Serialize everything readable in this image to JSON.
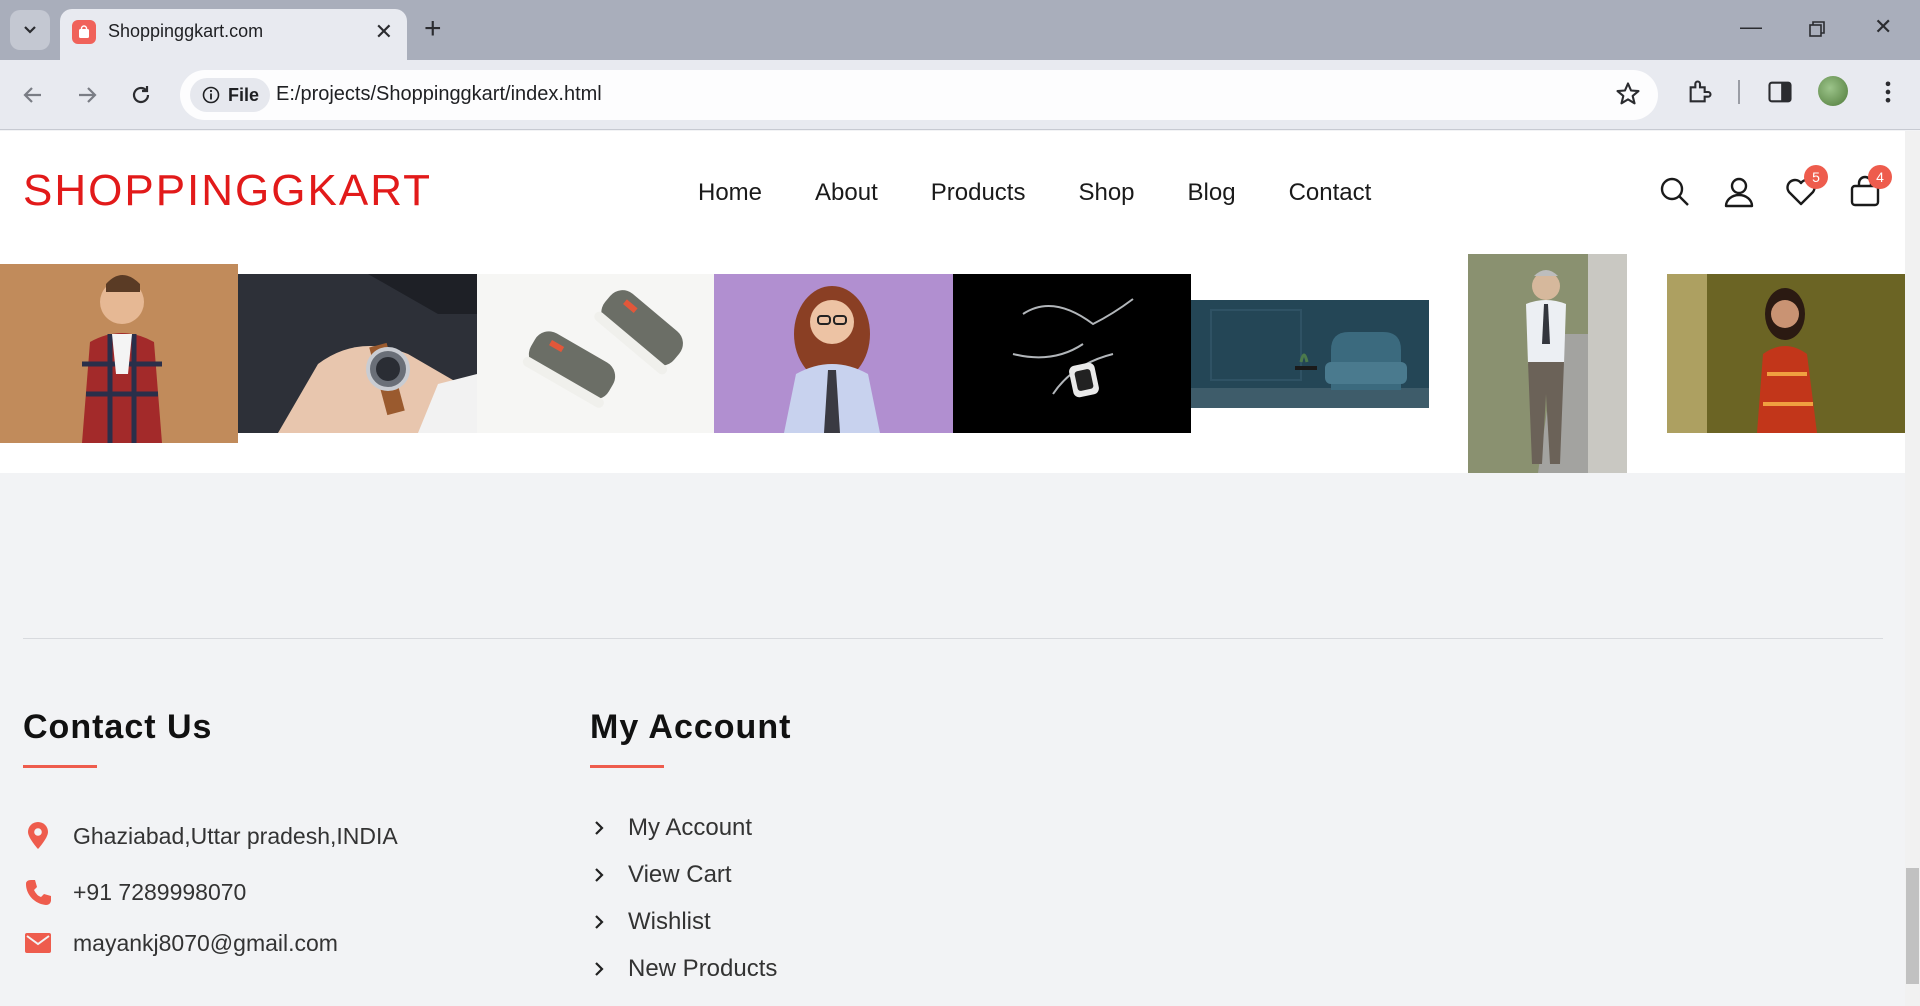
{
  "browser": {
    "tab_title": "Shoppinggkart.com",
    "url_chip": "File",
    "url": "E:/projects/Shoppinggkart/index.html",
    "colors": {
      "tabbar": "#a9aebb",
      "toolbar": "#e8eaf0",
      "favicon": "#f0625a"
    }
  },
  "header": {
    "logo": "SHOPPINGGKART",
    "nav": [
      "Home",
      "About",
      "Products",
      "Shop",
      "Blog",
      "Contact"
    ],
    "wishlist_count": "5",
    "cart_count": "4",
    "icons": [
      "search-icon",
      "user-icon",
      "heart-icon",
      "bag-icon"
    ]
  },
  "gallery": {
    "images": [
      "man-plaid-shirt",
      "wrist-watch",
      "sneakers",
      "woman-glasses",
      "smartwatch-splash",
      "blue-armchair",
      "man-walking",
      "woman-red-dress"
    ]
  },
  "footer": {
    "contact": {
      "title": "Contact Us",
      "address": "Ghaziabad,Uttar pradesh,INDIA",
      "phone": "+91 7289998070",
      "email": "mayankj8070@gmail.com"
    },
    "account": {
      "title": "My Account",
      "links": [
        "My Account",
        "View Cart",
        "Wishlist",
        "New Products"
      ]
    }
  },
  "colors": {
    "accent": "#ee5c4d",
    "logo": "#e21a1a",
    "page_bg": "#f2f3f5"
  }
}
